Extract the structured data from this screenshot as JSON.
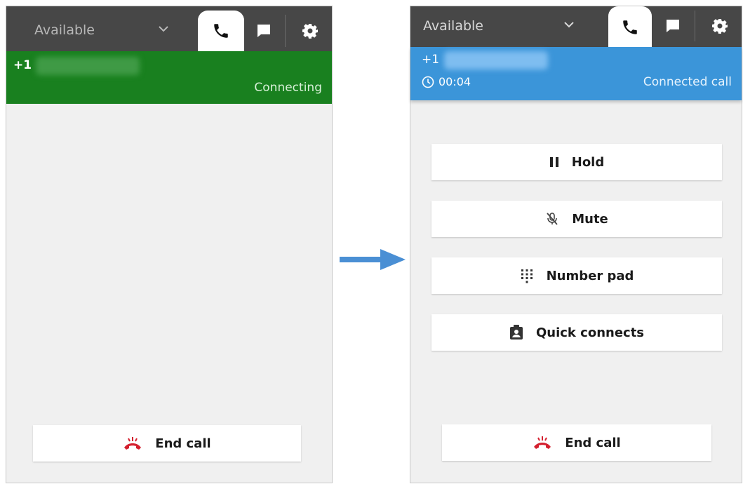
{
  "left_panel": {
    "status": "Available",
    "number_prefix": "+1",
    "call_status": "Connecting",
    "end_call_label": "End call"
  },
  "right_panel": {
    "status": "Available",
    "number_prefix": "+1",
    "timer": "00:04",
    "call_status": "Connected call",
    "hold_label": "Hold",
    "mute_label": "Mute",
    "number_pad_label": "Number pad",
    "quick_connects_label": "Quick connects",
    "end_call_label": "End call"
  },
  "colors": {
    "topbar": "#474747",
    "connecting": "#19801f",
    "connected": "#3b95d9",
    "end_call_icon": "#d4202f",
    "arrow": "#4a8fd4"
  },
  "icons": {
    "phone": "phone-icon",
    "chat": "chat-icon",
    "settings": "gear-icon",
    "dropdown": "chevron-down-icon",
    "clock": "clock-icon",
    "hold": "pause-icon",
    "mute": "mic-off-icon",
    "number_pad": "keypad-icon",
    "quick_connects": "contact-card-icon",
    "end_call": "hang-up-icon"
  }
}
